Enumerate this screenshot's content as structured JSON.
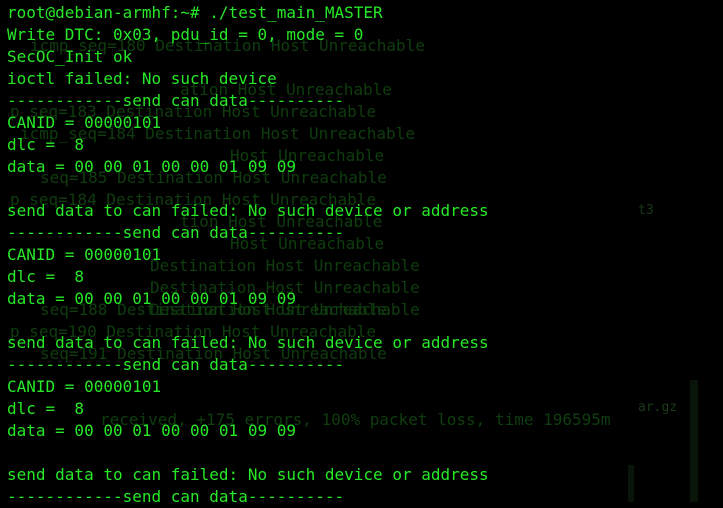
{
  "terminal": {
    "lines": [
      "root@debian-armhf:~# ./test_main_MASTER",
      "Write DTC: 0x03, pdu_id = 0, mode = 0",
      "SecOC_Init ok",
      "ioctl failed: No such device",
      "------------send can data----------",
      "CANID = 00000101",
      "dlc =  8",
      "data = 00 00 01 00 00 01 09 09",
      "",
      "send data to can failed: No such device or address",
      "------------send can data----------",
      "CANID = 00000101",
      "dlc =  8",
      "data = 00 00 01 00 00 01 09 09",
      "",
      "send data to can failed: No such device or address",
      "------------send can data----------",
      "CANID = 00000101",
      "dlc =  8",
      "data = 00 00 01 00 00 01 09 09",
      "",
      "send data to can failed: No such device or address",
      "------------send can data----------"
    ]
  },
  "background_ghost": {
    "lines": [
      "icmp_seq=180 Destination Host Unreachable",
      "ation Host Unreachable",
      "p seq=183 Destination Host Unreachable",
      "icmp_seq=184 Destination Host Unreachable",
      "Host Unreachable",
      "seq=185 Destination Host Unreachable",
      "p seq=184 Destination Host Unreachable",
      "tion Host Unreachable",
      "Host Unreachable",
      "Destination Host Unreachable",
      "Destination Host Unreachable",
      "Destination Host Unreachable",
      "seq=188 Destination Host Unreachable",
      "p seq=190 Destination Host Unreachable",
      "seq=191 Destination Host Unreachable",
      "received, +175 errors, 100% packet loss, time 196595m"
    ],
    "side_labels": [
      "t3",
      "ar.gz"
    ]
  }
}
